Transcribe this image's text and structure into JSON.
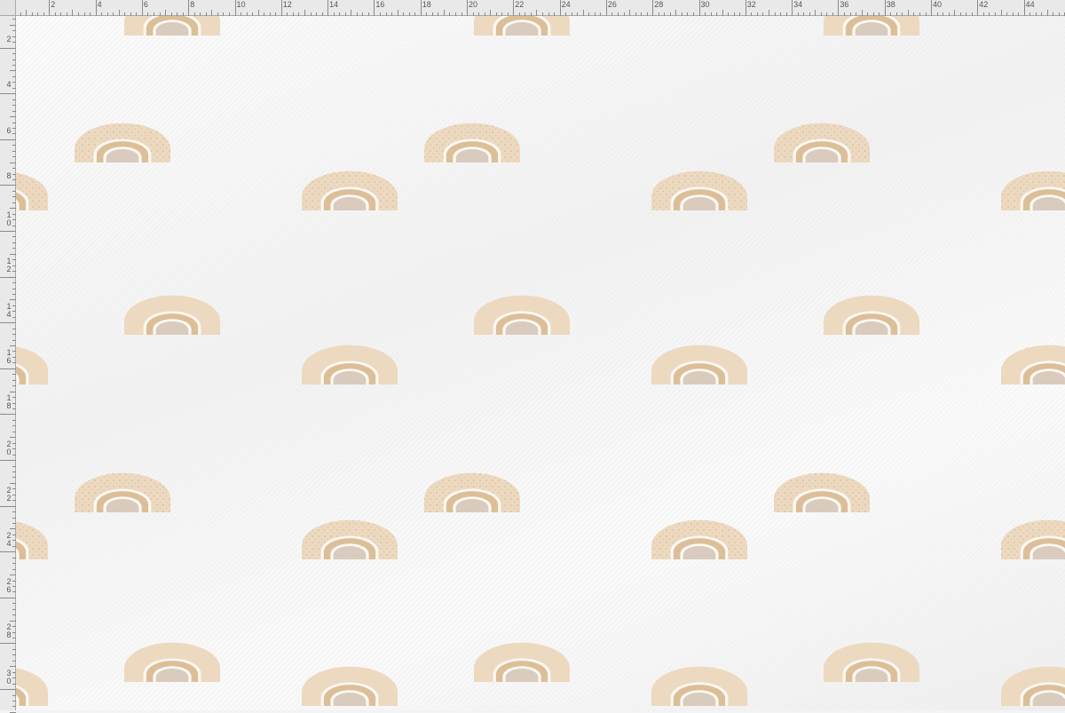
{
  "rulers": {
    "top_labels": [
      "2",
      "4",
      "6",
      "8",
      "10",
      "12",
      "14",
      "16",
      "18",
      "20",
      "22",
      "24",
      "26",
      "28",
      "30",
      "32",
      "34",
      "36",
      "38",
      "40",
      "42",
      "44"
    ],
    "left_labels": [
      [
        "2"
      ],
      [
        "4"
      ],
      [
        "6"
      ],
      [
        "8"
      ],
      [
        "1",
        "0"
      ],
      [
        "1",
        "2"
      ],
      [
        "1",
        "4"
      ],
      [
        "1",
        "6"
      ],
      [
        "1",
        "8"
      ],
      [
        "2",
        "0"
      ],
      [
        "2",
        "2"
      ],
      [
        "2",
        "4"
      ],
      [
        "2",
        "6"
      ],
      [
        "2",
        "8"
      ],
      [
        "3",
        "0"
      ]
    ]
  },
  "pattern": {
    "motif": "rainbow-arch",
    "colors": {
      "background": "#f6f6f6",
      "outer_band": "#ecd9c0",
      "middle_band": "#dcbf99",
      "gap_stripe": "#fbf8f3",
      "core": "#d9cbbd",
      "dots": "#c9a680"
    }
  }
}
